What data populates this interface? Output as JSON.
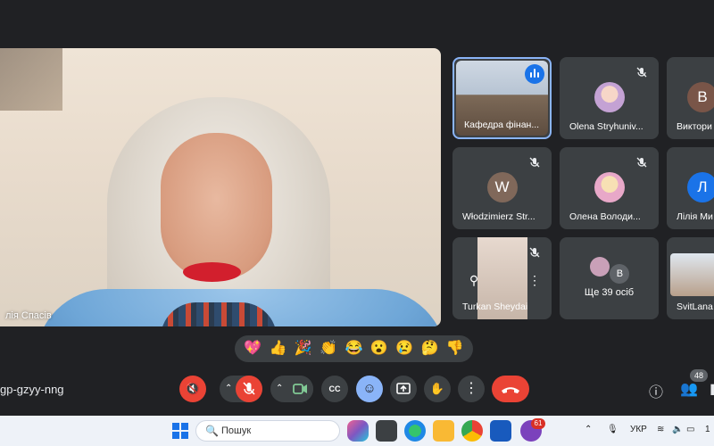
{
  "main_speaker": {
    "name": "лія Спасів"
  },
  "tiles": [
    {
      "name": "Кафедра фінан...",
      "speaking": true
    },
    {
      "name": "Olena Stryhuniv...",
      "muted": true
    },
    {
      "name": "Виктори",
      "avatar_letter": "В"
    },
    {
      "name": "Włodzimierz Str...",
      "avatar_letter": "W",
      "muted": true
    },
    {
      "name": "Олена Володи...",
      "muted": true
    },
    {
      "name": "Лілія Ми",
      "avatar_letter": "Л"
    },
    {
      "name": "Turkan Sheydai",
      "muted": true
    },
    {
      "name": "Ще 39 осіб",
      "avatar_letter": "В"
    },
    {
      "name": "SvitLana"
    }
  ],
  "reactions": [
    "💖",
    "👍",
    "🎉",
    "👏",
    "😂",
    "😮",
    "😢",
    "🤔",
    "👎"
  ],
  "controls": {
    "meeting_code": "gp-gzyy-nng",
    "participants_count": "48",
    "icons": {
      "speaker": "🔇",
      "mic": "🎙",
      "camera": "📹",
      "captions": "CC",
      "emoji": "☺",
      "present": "⬆",
      "raise_hand": "✋",
      "more": "⋮",
      "hangup": "☎",
      "info": "ⓘ",
      "people": "👥"
    }
  },
  "taskbar": {
    "search_placeholder": "Пошук",
    "search_icon": "🔍",
    "language": "УКР",
    "notification_badge": "61",
    "clock_partial": "1"
  },
  "colors": {
    "accent": "#8ab4f8",
    "danger": "#ea4335",
    "bg": "#202124",
    "tile_bg": "#3c4043"
  }
}
